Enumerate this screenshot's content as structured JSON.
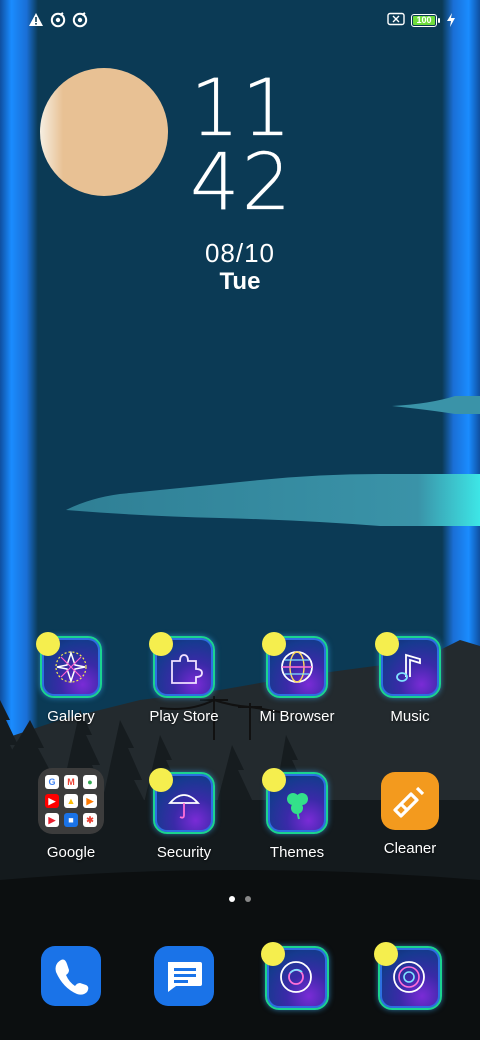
{
  "status_bar": {
    "left_icons": [
      "alert-icon",
      "data-saver-icon",
      "data-saver-icon-2"
    ],
    "right_icons": [
      "sim-off-icon",
      "battery-icon",
      "charging-icon"
    ],
    "battery_level": "100"
  },
  "clock": {
    "hours": "11",
    "minutes": "42",
    "date": "08/10",
    "day": "Tue"
  },
  "apps": [
    {
      "label": "Gallery",
      "icon": "gallery-icon"
    },
    {
      "label": "Play Store",
      "icon": "play-store-icon"
    },
    {
      "label": "Mi Browser",
      "icon": "mi-browser-icon"
    },
    {
      "label": "Music",
      "icon": "music-icon"
    },
    {
      "label": "Google",
      "icon": "google-folder-icon"
    },
    {
      "label": "Security",
      "icon": "security-icon"
    },
    {
      "label": "Themes",
      "icon": "themes-icon"
    },
    {
      "label": "Cleaner",
      "icon": "cleaner-icon"
    }
  ],
  "dock": [
    {
      "name": "Phone",
      "icon": "phone-icon"
    },
    {
      "name": "Messages",
      "icon": "messages-icon"
    },
    {
      "name": "Chrome",
      "icon": "chrome-icon"
    },
    {
      "name": "Camera",
      "icon": "camera-icon"
    }
  ],
  "page_indicator": {
    "pages": 2,
    "current": 1
  },
  "colors": {
    "sky": "#0b3a55",
    "sun": "#e8c194",
    "edge_glow": "#1a8cff",
    "cloud": "#2f7f95",
    "cloud_glow": "#3de6e6",
    "neon_moon": "#f5ee4e",
    "cleaner": "#f39a1e",
    "phone": "#1a73e8"
  }
}
